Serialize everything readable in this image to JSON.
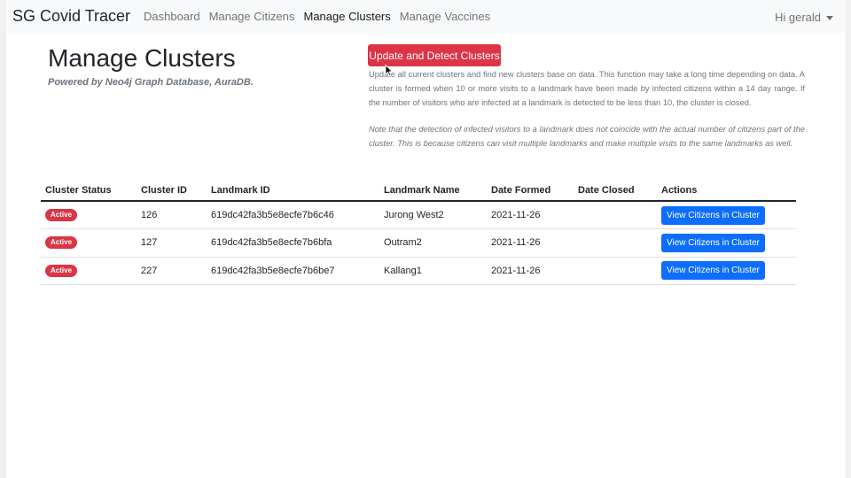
{
  "navbar": {
    "brand": "SG Covid Tracer",
    "links": [
      {
        "label": "Dashboard",
        "active": false
      },
      {
        "label": "Manage Citizens",
        "active": false
      },
      {
        "label": "Manage Clusters",
        "active": true
      },
      {
        "label": "Manage Vaccines",
        "active": false
      }
    ],
    "user_menu": "Hi gerald"
  },
  "header": {
    "title": "Manage Clusters",
    "subtitle": "Powered by Neo4j Graph Database, AuraDB."
  },
  "actions": {
    "detect_button": "Update and Detect Clusters",
    "description": "Update all current clusters and find new clusters base on data. This function may take a long time depending on data. A cluster is formed when 10 or more visits to a landmark have been made by infected citizens within a 14 day range. If the number of visitors who are infected at a landmark is detected to be less than 10, the cluster is closed.",
    "note": "Note that the detection of infected visitors to a landmark does not coincide with the actual number of citizens part of the cluster. This is because citizens can visit multiple landmarks and make multiple visits to the same landmarks as well."
  },
  "table": {
    "headers": [
      "Cluster Status",
      "Cluster ID",
      "Landmark ID",
      "Landmark Name",
      "Date Formed",
      "Date Closed",
      "Actions"
    ],
    "rows": [
      {
        "status": "Active",
        "cluster_id": "126",
        "landmark_id": "619dc42fa3b5e8ecfe7b6c46",
        "landmark_name": "Jurong West2",
        "date_formed": "2021-11-26",
        "date_closed": "",
        "action": "View Citizens in Cluster"
      },
      {
        "status": "Active",
        "cluster_id": "127",
        "landmark_id": "619dc42fa3b5e8ecfe7b6bfa",
        "landmark_name": "Outram2",
        "date_formed": "2021-11-26",
        "date_closed": "",
        "action": "View Citizens in Cluster"
      },
      {
        "status": "Active",
        "cluster_id": "227",
        "landmark_id": "619dc42fa3b5e8ecfe7b6be7",
        "landmark_name": "Kallang1",
        "date_formed": "2021-11-26",
        "date_closed": "",
        "action": "View Citizens in Cluster"
      }
    ]
  },
  "colors": {
    "danger": "#dc3545",
    "primary": "#0d6efd",
    "navbar_bg": "#f8f9fa",
    "muted_text": "#6c757d"
  },
  "icons": {
    "user_menu_toggle": "caret-down-icon",
    "pointer": "mouse-cursor-icon"
  }
}
